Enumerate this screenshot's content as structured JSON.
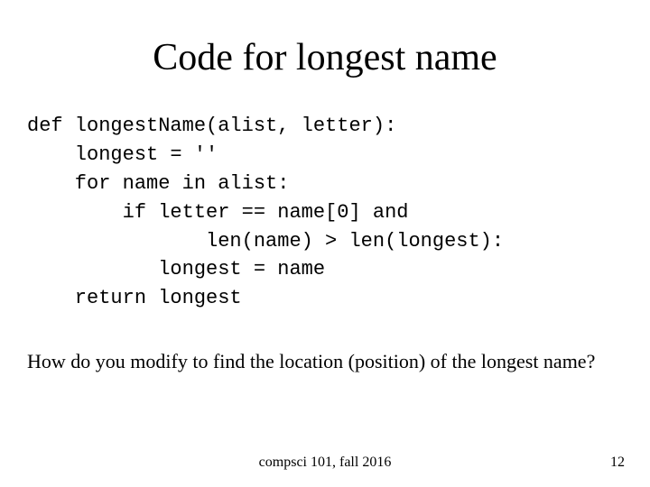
{
  "title": "Code for longest name",
  "code": "def longestName(alist, letter):\n    longest = ''\n    for name in alist:\n        if letter == name[0] and\n               len(name) > len(longest):\n           longest = name\n    return longest",
  "question": "How do you modify to find the location (position) of the longest name?",
  "footer_center": "compsci 101, fall 2016",
  "footer_page": "12"
}
